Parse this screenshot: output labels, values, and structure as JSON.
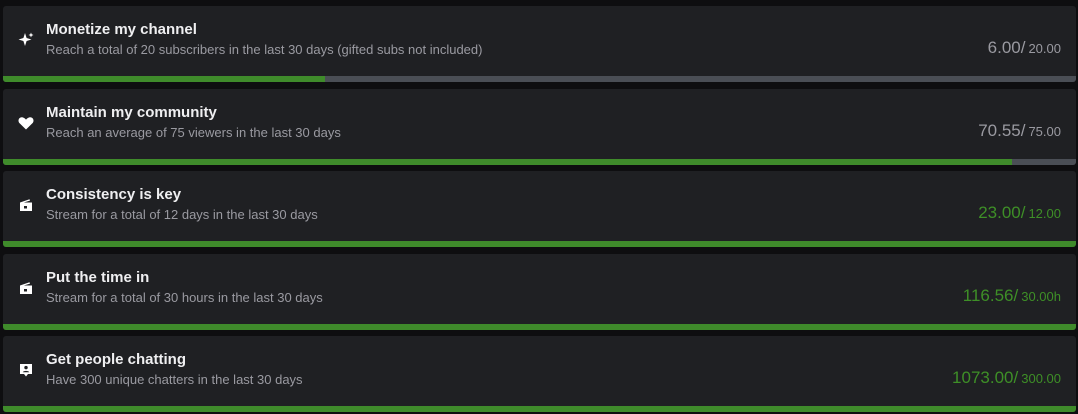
{
  "goals": [
    {
      "title": "Monetize my channel",
      "description": "Reach a total of 20 subscribers in the last 30 days (gifted subs not included)",
      "current": "6.00/",
      "target": "20.00",
      "icon": "sparkle-icon",
      "progress_fraction": 0.3,
      "complete": false
    },
    {
      "title": "Maintain my community",
      "description": "Reach an average of 75 viewers in the last 30 days",
      "current": "70.55/",
      "target": "75.00",
      "icon": "heart-icon",
      "progress_fraction": 0.9407,
      "complete": false
    },
    {
      "title": "Consistency is key",
      "description": "Stream for a total of 12 days in the last 30 days",
      "current": "23.00/",
      "target": "12.00",
      "icon": "broadcast-icon",
      "progress_fraction": 1.0,
      "complete": true
    },
    {
      "title": "Put the time in",
      "description": "Stream for a total of 30 hours in the last 30 days",
      "current": "116.56/",
      "target": "30.00h",
      "icon": "broadcast-icon",
      "progress_fraction": 1.0,
      "complete": true
    },
    {
      "title": "Get people chatting",
      "description": "Have 300 unique chatters in the last 30 days",
      "current": "1073.00/",
      "target": "300.00",
      "icon": "chat-bubble-icon",
      "progress_fraction": 1.0,
      "complete": true
    }
  ],
  "colors": {
    "card_background": "#1f2023",
    "bar_track": "#4a4e55",
    "bar_fill": "#3f8b2b",
    "complete_text": "#3e8f27",
    "incomplete_text": "#9a9aa1"
  }
}
